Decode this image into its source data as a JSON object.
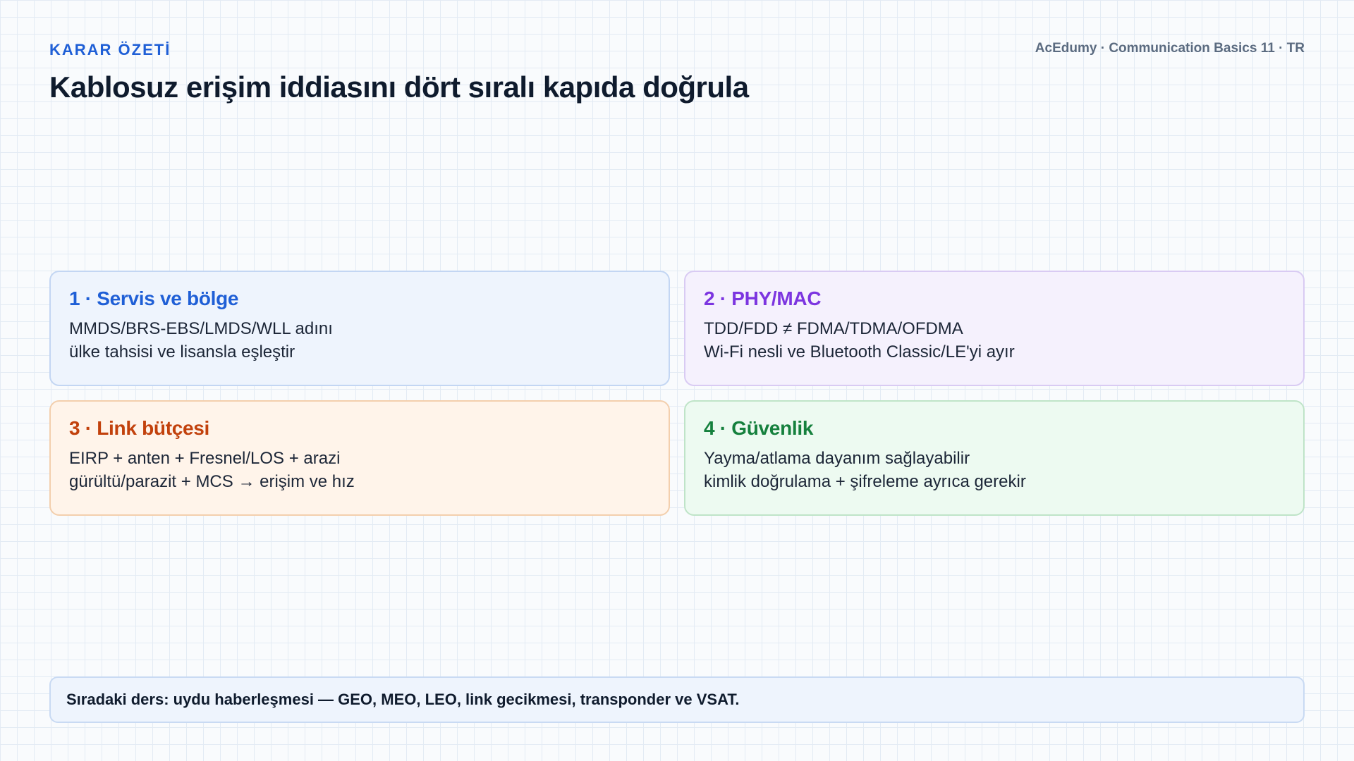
{
  "header": {
    "eyebrow": "KARAR ÖZETİ",
    "brand": "AcEdumy · Communication Basics 11 · TR",
    "title": "Kablosuz erişim iddiasını dört sıralı kapıda doğrula"
  },
  "cards": [
    {
      "title": "1 · Servis ve bölge",
      "lines": [
        "MMDS/BRS-EBS/LMDS/WLL adını",
        "ülke tahsisi ve lisansla eşleştir"
      ],
      "accent": "#1f5fd6"
    },
    {
      "title": "2 · PHY/MAC",
      "lines": [
        "TDD/FDD ≠ FDMA/TDMA/OFDMA",
        "Wi-Fi nesli ve Bluetooth Classic/LE'yi ayır"
      ],
      "accent": "#7c35e0"
    },
    {
      "title": "3 · Link bütçesi",
      "lines": [
        "EIRP + anten + Fresnel/LOS + arazi",
        "gürültü/parazit + MCS → erişim ve hız"
      ],
      "accent": "#c2410c"
    },
    {
      "title": "4 · Güvenlik",
      "lines": [
        "Yayma/atlama dayanım sağlayabilir",
        "kimlik doğrulama + şifreleme ayrıca gerekir"
      ],
      "accent": "#15803d"
    }
  ],
  "footer": {
    "text": "Sıradaki ders: uydu haberleşmesi — GEO, MEO, LEO, link gecikmesi, transponder ve VSAT."
  }
}
